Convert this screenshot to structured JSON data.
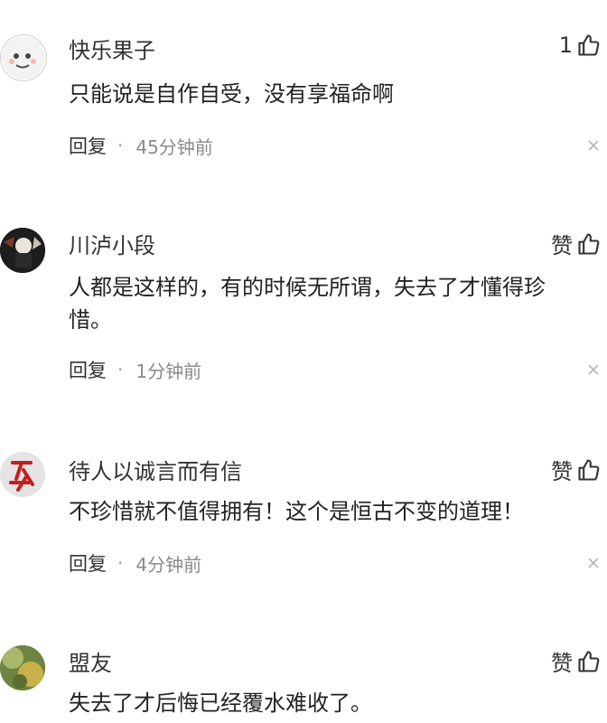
{
  "comments": [
    {
      "username": "快乐果子",
      "text": "只能说是自作自受，没有享福命啊",
      "like_label": "1",
      "reply_label": "回复",
      "separator": "·",
      "time": "45分钟前"
    },
    {
      "username": "川泸小段",
      "text": "人都是这样的，有的时候无所谓，失去了才懂得珍惜。",
      "like_label": "赞",
      "reply_label": "回复",
      "separator": "·",
      "time": "1分钟前"
    },
    {
      "username": "待人以诚言而有信",
      "text": "不珍惜就不值得拥有！这个是恒古不变的道理！",
      "like_label": "赞",
      "reply_label": "回复",
      "separator": "·",
      "time": "4分钟前"
    },
    {
      "username": "盟友",
      "text": "失去了才后悔已经覆水难收了。",
      "like_label": "赞"
    }
  ],
  "colors": {
    "text": "#222222",
    "meta": "#8a8a8a",
    "background": "#ffffff"
  },
  "icons": {
    "like": "thumbs-up-icon",
    "close": "close-icon"
  }
}
